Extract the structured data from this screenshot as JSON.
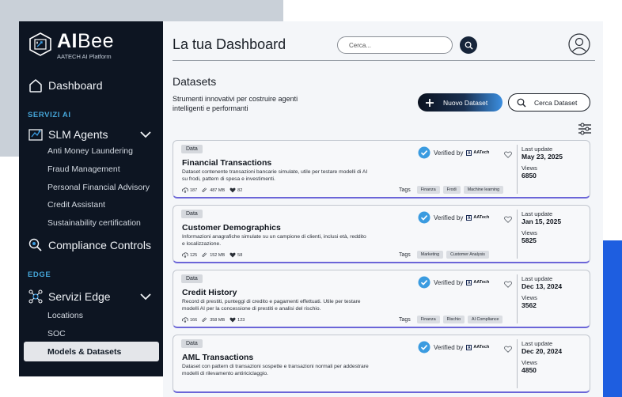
{
  "sidebar": {
    "logo": {
      "title_bold": "AI",
      "title_rest": "Bee",
      "subtitle": "AATECH AI Platform"
    },
    "dashboard_label": "Dashboard",
    "section_ai": "SERVIZI AI",
    "slm": {
      "label": "SLM Agents",
      "items": [
        "Anti Money Laundering",
        "Fraud Management",
        "Personal Financial Advisory",
        "Credit Assistant",
        "Sustainability certification"
      ]
    },
    "compliance_label": "Compliance Controls",
    "section_edge": "EDGE",
    "edge": {
      "label": "Servizi Edge",
      "items": [
        "Locations",
        "SOC",
        "Models & Datasets"
      ]
    }
  },
  "header": {
    "title": "La tua Dashboard",
    "search_placeholder": "Cerca..."
  },
  "section": {
    "title": "Datasets",
    "description": "Strumenti innovativi per costruire agenti intelligenti e performanti",
    "new_button": "Nuovo Dataset",
    "find_button": "Cerca Dataset"
  },
  "labels": {
    "badge": "Data",
    "verified_by": "Verified by",
    "brand": "AATech",
    "tags": "Tags",
    "last_update": "Last update",
    "views": "Views"
  },
  "datasets": [
    {
      "title": "Financial Transactions",
      "description": "Dataset contenente transazioni bancarie simulate, utile per testare modelli di AI su frodi, pattern di spesa e investimenti.",
      "downloads": "187",
      "size": "487 MB",
      "likes": "82",
      "tags": [
        "Finanza",
        "Frodi",
        "Machine learning"
      ],
      "last_update": "May 23, 2025",
      "views": "6850"
    },
    {
      "title": "Customer Demographics",
      "description": "Informazioni anagrafiche simulate su un campione di clienti, inclusi età, reddito e localizzazione.",
      "downloads": "125",
      "size": "152 MB",
      "likes": "58",
      "tags": [
        "Marketing",
        "Customer Analysis"
      ],
      "last_update": "Jan 15, 2025",
      "views": "5825"
    },
    {
      "title": "Credit History",
      "description": "Record di prestiti, punteggi di credito e pagamenti effettuati. Utile per testare modelli AI per la concessione di prestiti e analisi del rischio.",
      "downloads": "166",
      "size": "358 MB",
      "likes": "123",
      "tags": [
        "Finanza",
        "Rischio",
        "AI Compliance"
      ],
      "last_update": "Dec 13, 2024",
      "views": "3562"
    },
    {
      "title": "AML Transactions",
      "description": "Dataset con pattern di transazioni sospette e transazioni normali per addestrare modelli di rilevamento antiriciclaggio.",
      "downloads": "",
      "size": "",
      "likes": "",
      "tags": [],
      "last_update": "Dec 20, 2024",
      "views": "4850"
    }
  ],
  "colors": {
    "sidebar_bg": "#0d1522",
    "section_label": "#45a5d8",
    "card_accent": "#6b65d8",
    "verified": "#3a9be0",
    "deco_blue": "#1e5ee0"
  }
}
